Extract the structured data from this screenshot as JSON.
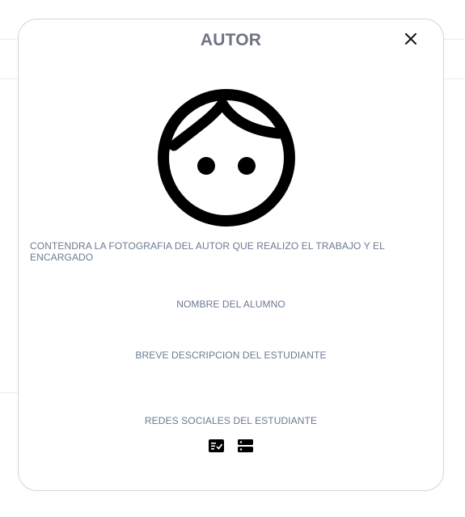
{
  "modal": {
    "title": "AUTOR",
    "photo_caption": "CONTENDRA LA FOTOGRAFIA DEL AUTOR QUE REALIZO EL TRABAJO Y EL ENCARGADO",
    "student_name": "NOMBRE DEL ALUMNO",
    "student_description": "BREVE DESCRIPCION DEL ESTUDIANTE",
    "social_title": "REDES SOCIALES DEL ESTUDIANTE",
    "icons": {
      "close": "close-icon",
      "avatar": "child-face-icon",
      "social": [
        "checklist-icon",
        "server-icon"
      ]
    }
  }
}
